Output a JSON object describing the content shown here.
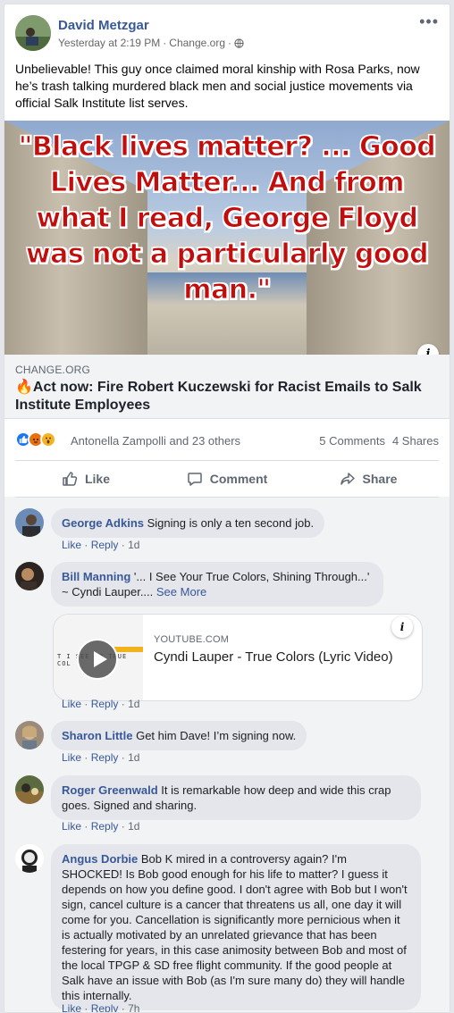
{
  "post": {
    "author": "David Metzgar",
    "timestamp": "Yesterday at 2:19 PM",
    "source": "Change.org",
    "separator": "·",
    "privacy_icon": "globe-icon",
    "more_icon": "more-options-icon",
    "text": "Unbelievable! This guy once claimed moral kinship with Rosa Parks, now he’s trash talking murdered black men and social justice movements via official Salk Institute list serves."
  },
  "link": {
    "image_quote": "\"Black lives matter? ... Good Lives Matter... And from what I read, George Floyd was not a particularly good man.\"",
    "info_label": "i",
    "source": "CHANGE.ORG",
    "title_icon": "🔥",
    "title": "Act now: Fire Robert Kuczewski for Racist Emails to Salk Institute Employees"
  },
  "reactions": {
    "icons": [
      "like-reaction-icon",
      "angry-reaction-icon",
      "wow-reaction-icon"
    ],
    "names": "Antonella Zampolli and 23 others",
    "comments": "5 Comments",
    "shares": "4 Shares"
  },
  "actions": {
    "like": "Like",
    "comment": "Comment",
    "share": "Share"
  },
  "comment_actions": {
    "like": "Like",
    "reply": "Reply",
    "sep": "·"
  },
  "comments": [
    {
      "name": "George Adkins",
      "text": "Signing is only a ten second job.",
      "time": "1d"
    },
    {
      "name": "Bill Manning",
      "text_line1": "'... I See Your True Colors, Shining Through...'",
      "text_line2": "~ Cyndi Lauper....",
      "see_more": "See More",
      "time": "1d",
      "attachment": {
        "thumb_text": "T I SEE YO   TRUE COL",
        "source": "YOUTUBE.COM",
        "title": "Cyndi Lauper - True Colors (Lyric Video)",
        "info_label": "i"
      }
    },
    {
      "name": "Sharon Little",
      "text": "Get him Dave! I’m signing now.",
      "time": "1d"
    },
    {
      "name": "Roger Greenwald",
      "text": "It is remarkable how deep and wide this crap goes. Signed and sharing.",
      "time": "1d"
    },
    {
      "name": "Angus Dorbie",
      "text": "Bob K mired in a controversy again? I'm SHOCKED! Is Bob good enough for his life to matter? I guess it depends on how you define good. I don't agree with Bob but I won't sign, cancel culture is a cancer that threatens us all, one day it will come for you. Cancellation is significantly more pernicious when it is actually motivated by an unrelated grievance that has been festering for years, in this case animosity between Bob and most of the local TPGP & SD free flight community. If the good people at Salk have an issue with Bob (as I'm sure many do) they will handle this internally.",
      "time": "7h"
    }
  ],
  "colors": {
    "link_blue": "#385898",
    "facebook_blue": "#1877f2",
    "quote_red": "#c20d0d",
    "bubble_gray": "#e4e6eb"
  }
}
